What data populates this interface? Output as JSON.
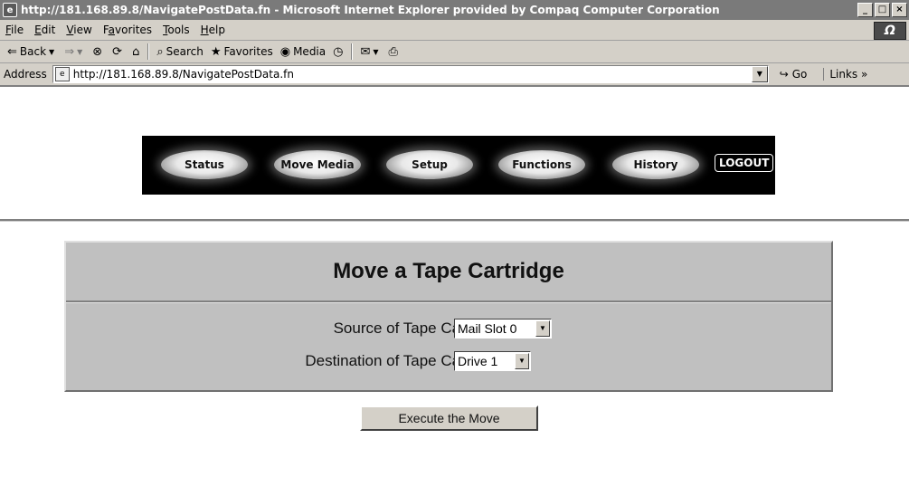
{
  "window": {
    "title": "http://181.168.89.8/NavigatePostData.fn - Microsoft Internet Explorer provided by Compaq Computer Corporation",
    "controls": [
      "_",
      "□",
      "×"
    ]
  },
  "menu": {
    "items": [
      {
        "accel": "F",
        "rest": "ile"
      },
      {
        "accel": "E",
        "rest": "dit"
      },
      {
        "accel": "V",
        "rest": "iew"
      },
      {
        "pre": "F",
        "accel": "a",
        "rest": "vorites"
      },
      {
        "accel": "T",
        "rest": "ools"
      },
      {
        "accel": "H",
        "rest": "elp"
      }
    ]
  },
  "toolbar": {
    "back": "Back",
    "search": "Search",
    "favorites": "Favorites",
    "media": "Media"
  },
  "address": {
    "label": "Address",
    "url": "http://181.168.89.8/NavigatePostData.fn",
    "go": "Go",
    "links": "Links"
  },
  "nav": {
    "buttons": [
      "Status",
      "Move Media",
      "Setup",
      "Functions",
      "History"
    ],
    "logout": "LOGOUT"
  },
  "panel": {
    "title": "Move a Tape Cartridge",
    "source_label": "Source of Tape Cartridge:",
    "source_value": "Mail Slot 0",
    "destination_label": "Destination of Tape Cartridge:",
    "destination_value": "Drive 1"
  },
  "execute_label": "Execute the Move"
}
